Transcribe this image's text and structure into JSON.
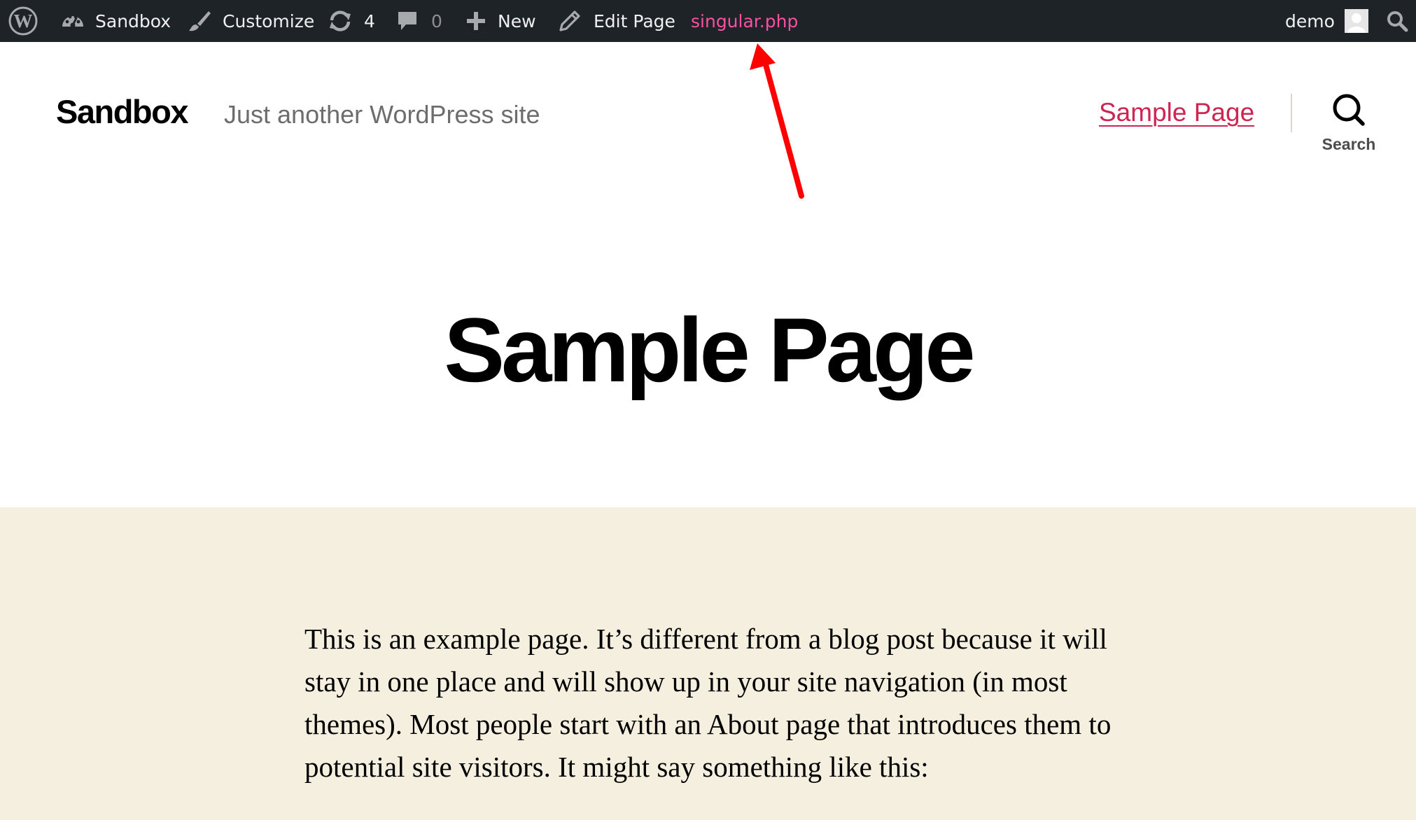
{
  "admin_bar": {
    "site_name": "Sandbox",
    "customize_label": "Customize",
    "updates_count": "4",
    "comments_count": "0",
    "new_label": "New",
    "edit_label": "Edit Page",
    "template_file": "singular.php",
    "user_name": "demo",
    "template_color": "#ff4fa3",
    "icons": [
      "wordpress-logo-icon",
      "dashboard-icon",
      "paintbrush-icon",
      "updates-icon",
      "comment-icon",
      "plus-icon",
      "pencil-icon",
      "avatar-icon",
      "search-icon"
    ]
  },
  "header": {
    "site_title": "Sandbox",
    "site_description": "Just another WordPress site",
    "nav_items": [
      {
        "label": "Sample Page"
      }
    ],
    "search_label": "Search",
    "accent_color": "#cd2653"
  },
  "annotation": {
    "arrow_color": "#ff0000"
  },
  "page": {
    "title": "Sample Page",
    "content_background": "#f5efe0",
    "content_text": "This is an example page. It’s different from a blog post because it will stay in one place and will show up in your site navigation (in most themes). Most people start with an About page that introduces them to potential site visitors. It might say something like this:"
  }
}
